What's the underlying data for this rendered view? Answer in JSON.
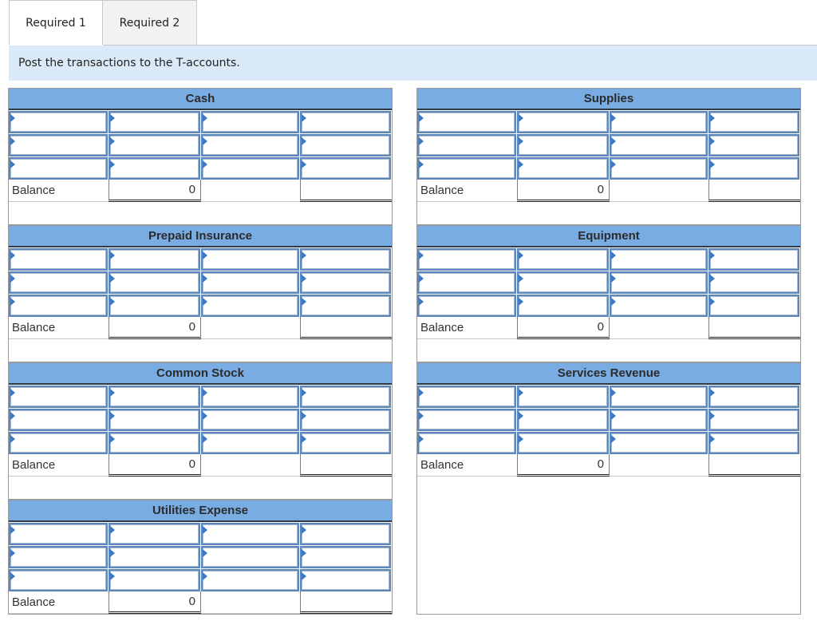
{
  "tabs": [
    {
      "label": "Required 1",
      "active": true
    },
    {
      "label": "Required 2",
      "active": false
    }
  ],
  "instruction": "Post the transactions to the T-accounts.",
  "balance_label": "Balance",
  "accounts_left": [
    {
      "title": "Cash",
      "balance_debit": "0",
      "balance_credit": ""
    },
    {
      "title": "Prepaid Insurance",
      "balance_debit": "0",
      "balance_credit": ""
    },
    {
      "title": "Common Stock",
      "balance_debit": "0",
      "balance_credit": ""
    },
    {
      "title": "Utilities Expense",
      "balance_debit": "0",
      "balance_credit": ""
    }
  ],
  "accounts_right": [
    {
      "title": "Supplies",
      "balance_debit": "0",
      "balance_credit": ""
    },
    {
      "title": "Equipment",
      "balance_debit": "0",
      "balance_credit": ""
    },
    {
      "title": "Services Revenue",
      "balance_debit": "0",
      "balance_credit": ""
    }
  ],
  "entry_rows_per_account": 3,
  "entry_columns": [
    "debit-description",
    "debit-amount",
    "credit-description",
    "credit-amount"
  ]
}
